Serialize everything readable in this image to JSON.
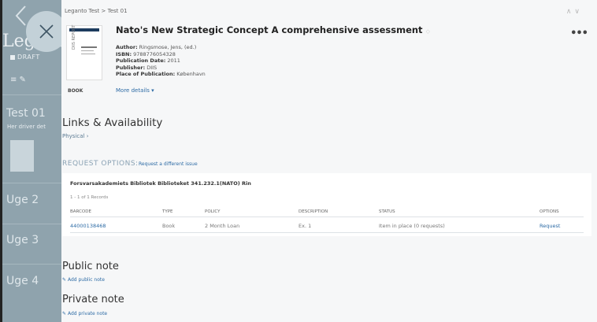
{
  "background": {
    "course_title": "Leganto",
    "status": "DRAFT",
    "section_title": "Test 01",
    "section_subtitle": "Her driver det",
    "weeks": [
      "Uge 2",
      "Uge 3",
      "Uge 4"
    ]
  },
  "breadcrumb": "Leganto Test > Test 01",
  "item": {
    "title": "Nato's New Strategic Concept A comprehensive assessment",
    "type": "BOOK",
    "cover_text": "DIIS REPORT",
    "more_details": "More details",
    "metadata": [
      {
        "key": "Author:",
        "value": "Ringsmose, Jens, (ed.)"
      },
      {
        "key": "ISBN:",
        "value": "9788776054328"
      },
      {
        "key": "Publication Date:",
        "value": "2011"
      },
      {
        "key": "Publisher:",
        "value": "DIIS"
      },
      {
        "key": "Place of Publication:",
        "value": "København"
      }
    ]
  },
  "links": {
    "title": "Links & Availability",
    "physical": "Physical"
  },
  "request": {
    "label": "REQUEST OPTIONS:",
    "different_issue": "Request a different issue",
    "location": "Forsvarsakademiets Bibliotek  Biblioteket  341.232.1(NATO) Rin",
    "records": "1 - 1 of 1 Records",
    "columns": [
      "BARCODE",
      "TYPE",
      "POLICY",
      "DESCRIPTION",
      "STATUS",
      "OPTIONS"
    ],
    "row": {
      "barcode": "44000138468",
      "type": "Book",
      "policy": "2 Month Loan",
      "description": "Ex. 1",
      "status": "Item in place (0 requests)",
      "option": "Request"
    }
  },
  "public_note": {
    "title": "Public note",
    "add": "Add public note"
  },
  "private_note": {
    "title": "Private note",
    "add": "Add private note"
  }
}
